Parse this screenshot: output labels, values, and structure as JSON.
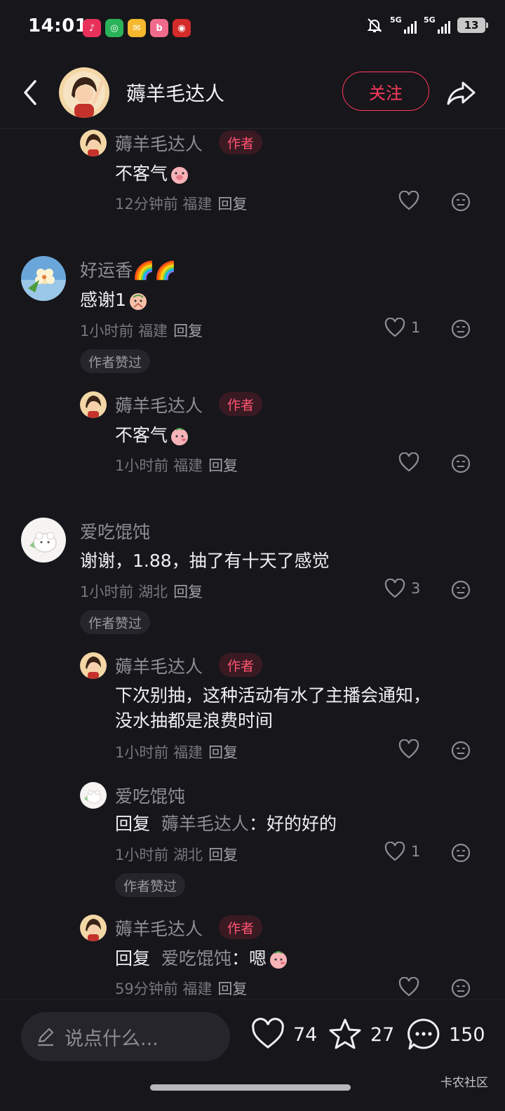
{
  "status_bar": {
    "time": "14:01",
    "apps": [
      {
        "icon": "douyin-icon",
        "color": "#e8305b",
        "glyph": "♪"
      },
      {
        "icon": "browser-icon",
        "color": "#2bb35a",
        "glyph": "◎"
      },
      {
        "icon": "mail-icon",
        "color": "#f5b82e",
        "glyph": "✉"
      },
      {
        "icon": "bilibili-icon",
        "color": "#f06a8c",
        "glyph": "b"
      },
      {
        "icon": "bank-icon",
        "color": "#d42b2b",
        "glyph": "◉"
      }
    ],
    "signal_1": "5G",
    "signal_2": "5G",
    "battery": "13"
  },
  "header": {
    "name": "薅羊毛达人",
    "follow_label": "关注"
  },
  "comments": [
    {
      "name": "薅羊毛达人",
      "author_tag": "作者",
      "text": "不客气",
      "time": "12分钟前",
      "location": "福建",
      "reply": "回复",
      "likes": ""
    },
    {
      "name": "好运香",
      "name_suffix": "🌈🌈",
      "text": "感谢1",
      "time": "1小时前",
      "location": "福建",
      "reply": "回复",
      "likes": "1",
      "liked_badge": "作者赞过"
    },
    {
      "name": "薅羊毛达人",
      "author_tag": "作者",
      "text": "不客气",
      "time": "1小时前",
      "location": "福建",
      "reply": "回复",
      "likes": ""
    },
    {
      "name": "爱吃馄饨",
      "text": "谢谢，1.88，抽了有十天了感觉",
      "time": "1小时前",
      "location": "湖北",
      "reply": "回复",
      "likes": "3",
      "liked_badge": "作者赞过"
    },
    {
      "name": "薅羊毛达人",
      "author_tag": "作者",
      "text_line1": "下次别抽，这种活动有水了主播会通知，",
      "text_line2": "没水抽都是浪费时间",
      "time": "1小时前",
      "location": "福建",
      "reply": "回复",
      "likes": ""
    },
    {
      "name": "爱吃馄饨",
      "reply_prefix": "回复",
      "reply_to": "薅羊毛达人",
      "text": "：好的好的",
      "time": "1小时前",
      "location": "湖北",
      "reply": "回复",
      "likes": "1",
      "liked_badge": "作者赞过"
    },
    {
      "name": "薅羊毛达人",
      "author_tag": "作者",
      "reply_prefix": "回复",
      "reply_to": "爱吃馄饨",
      "text": "：嗯",
      "time": "59分钟前",
      "location": "福建",
      "reply": "回复",
      "likes": ""
    }
  ],
  "bottom_bar": {
    "input_placeholder": "说点什么...",
    "like_count": "74",
    "star_count": "27",
    "comment_count": "150",
    "watermark": "卡农社区"
  }
}
